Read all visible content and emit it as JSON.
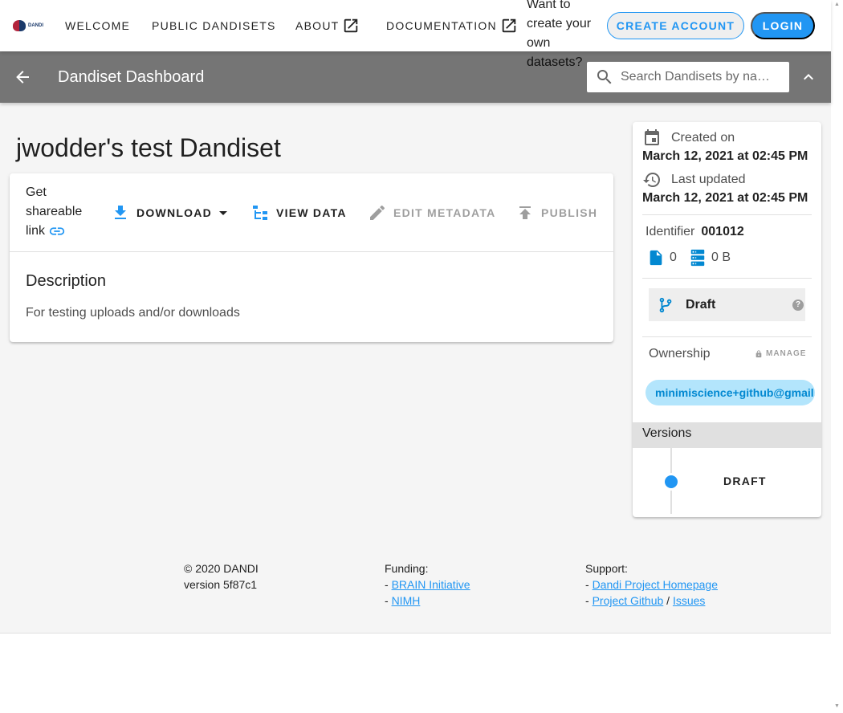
{
  "topbar": {
    "logo_text": "DANDI",
    "nav": {
      "welcome": "WELCOME",
      "public_dandisets": "PUBLIC DANDISETS",
      "about": "ABOUT",
      "documentation": "DOCUMENTATION"
    },
    "cta_text": "Want to create your own datasets?",
    "create_account": "CREATE ACCOUNT",
    "login": "LOGIN"
  },
  "subbar": {
    "title": "Dandiset Dashboard",
    "search_placeholder": "Search Dandisets by na…"
  },
  "dandiset": {
    "title": "jwodder's test Dandiset",
    "actions": {
      "share": "Get shareable link",
      "download": "DOWNLOAD",
      "view_data": "VIEW DATA",
      "edit_metadata": "EDIT METADATA",
      "publish": "PUBLISH"
    },
    "description_heading": "Description",
    "description": "For testing uploads and/or downloads"
  },
  "meta": {
    "created_label": "Created on",
    "created_value": "March 12, 2021 at 02:45 PM",
    "updated_label": "Last updated",
    "updated_value": "March 12, 2021 at 02:45 PM",
    "identifier_label": "Identifier",
    "identifier_value": "001012",
    "file_count": "0",
    "size": "0 B",
    "draft_label": "Draft",
    "help_glyph": "?",
    "ownership_label": "Ownership",
    "manage_label": "MANAGE",
    "owner": "minimiscience+github@gmail.com",
    "versions_label": "Versions",
    "version_draft": "DRAFT"
  },
  "footer": {
    "copyright": "© 2020 DANDI",
    "version": "version 5f87c1",
    "funding_label": "Funding:",
    "funding_links": [
      "BRAIN Initiative",
      "NIMH"
    ],
    "support_label": "Support:",
    "support_links": [
      "Dandi Project Homepage",
      "Project Github",
      "Issues"
    ],
    "dash": "-",
    "sep": "/"
  },
  "colors": {
    "primary": "#2196f3",
    "subbar": "#757575",
    "chip_bg": "#b3e5fc",
    "chip_text": "#0288d1"
  },
  "icons": [
    "open-in-new-icon",
    "arrow-back-icon",
    "magnify-icon",
    "chevron-up-icon",
    "link-icon",
    "download-icon",
    "menu-down-icon",
    "file-tree-icon",
    "pencil-icon",
    "upload-icon",
    "calendar-icon",
    "history-icon",
    "file-icon",
    "database-icon",
    "source-branch-icon",
    "help-circle-icon",
    "lock-icon"
  ]
}
